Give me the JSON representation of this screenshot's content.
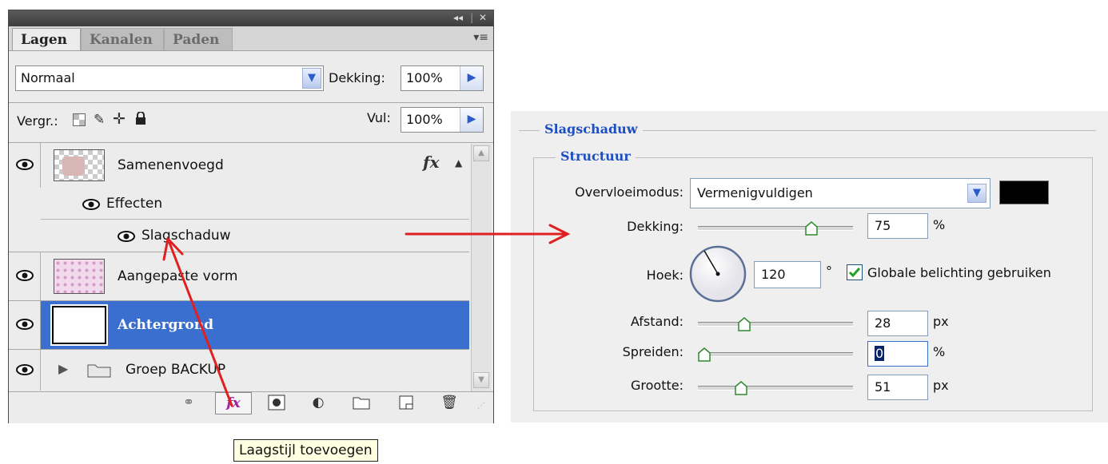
{
  "layers_panel": {
    "title_controls": [
      "◂◂",
      "|",
      "✕"
    ],
    "tabs": [
      {
        "label": "Lagen"
      },
      {
        "label": "Kanalen"
      },
      {
        "label": "Paden"
      }
    ],
    "blend_mode": "Normaal",
    "opacity_label": "Dekking:",
    "opacity_value": "100%",
    "lock_label": "Vergr.:",
    "fill_label": "Vul:",
    "fill_value": "100%",
    "layers": [
      {
        "name": "Samenenvoegd",
        "fx": "fx"
      },
      {
        "name": "Effecten"
      },
      {
        "name": "Slagschaduw"
      },
      {
        "name": "Aangepaste vorm"
      },
      {
        "name": "Achtergrond"
      },
      {
        "name": "Groep BACKUP"
      }
    ],
    "selected_layer": "Achtergrond",
    "bottom_icons": [
      "link-icon",
      "fx-icon",
      "mask-icon",
      "adjustment-icon",
      "folder-icon",
      "new-layer-icon",
      "trash-icon"
    ],
    "fx_button": "fx",
    "tooltip": "Laagstijl toevoegen"
  },
  "drop_shadow": {
    "section_title": "Slagschaduw",
    "group_title": "Structuur",
    "blend_label": "Overvloeimodus:",
    "blend_value": "Vermenigvuldigen",
    "shadow_color": "#000000",
    "opacity": {
      "label": "Dekking:",
      "value": "75",
      "unit": "%",
      "slider": 0.75
    },
    "angle": {
      "label": "Hoek:",
      "value": "120",
      "unit": "°"
    },
    "global_light_label": "Globale belichting gebruiken",
    "global_light_checked": true,
    "distance": {
      "label": "Afstand:",
      "value": "28",
      "unit": "px",
      "slider": 0.28
    },
    "spread": {
      "label": "Spreiden:",
      "value": "0",
      "unit": "%",
      "slider": 0.0
    },
    "size": {
      "label": "Grootte:",
      "value": "51",
      "unit": "px",
      "slider": 0.26
    }
  },
  "colors": {
    "selection": "#3a6fcf",
    "arrow": "#e02020",
    "group_title": "#1e4fc2"
  }
}
